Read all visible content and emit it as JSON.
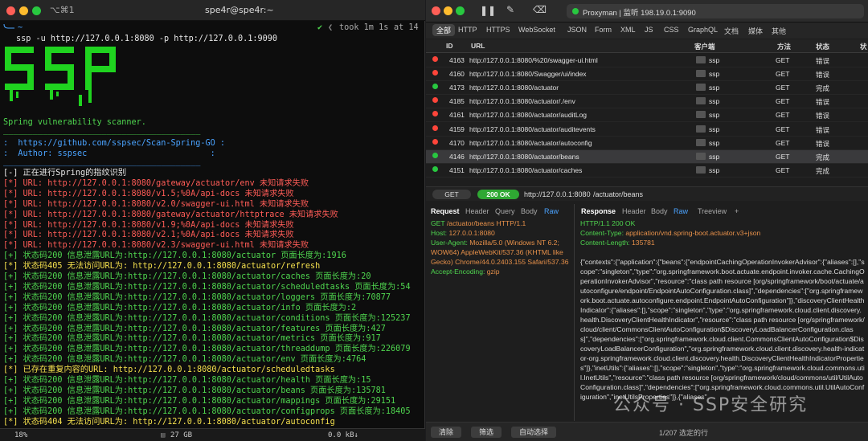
{
  "terminal": {
    "shortcut": "⌥⌘1",
    "title": "spe4r@spe4r:~",
    "prompt_status": "✔",
    "took": "took 1m 1s",
    "at": "at 14",
    "command": "ssp -u http://127.0.0.1:8080 -p http://127.0.0.1:9090",
    "tagline": "Spring vulnerability scanner.",
    "sep": "________________________________________",
    "url_line": ":  https://github.com/sspsec/Scan-Spring-GO :",
    "author_line": ":  Author: sspsec                         :",
    "lines": [
      {
        "text": "[-] 正在进行Spring的指纹识别",
        "color": "#e8e8e8"
      },
      {
        "text": "[*] URL: http://127.0.0.1:8080/gateway/actuator/env 未知请求失败",
        "color": "#ff5c57"
      },
      {
        "text": "[*] URL: http://127.0.0.1:8080/v1.5;%0A/api-docs 未知请求失败",
        "color": "#ff5c57"
      },
      {
        "text": "[*] URL: http://127.0.0.1:8080/v2.0/swagger-ui.html 未知请求失败",
        "color": "#ff5c57"
      },
      {
        "text": "[*] URL: http://127.0.0.1:8080/gateway/actuator/httptrace 未知请求失败",
        "color": "#ff5c57"
      },
      {
        "text": "[*] URL: http://127.0.0.1:8080/v1.9;%0A/api-docs 未知请求失败",
        "color": "#ff5c57"
      },
      {
        "text": "[*] URL: http://127.0.0.1:8080/v2.1;%0A/api-docs 未知请求失败",
        "color": "#ff5c57"
      },
      {
        "text": "[*] URL: http://127.0.0.1:8080/v2.3/swagger-ui.html 未知请求失败",
        "color": "#ff5c57"
      },
      {
        "text": "[+] 状态码200 信息泄露URL为:http://127.0.0.1:8080/actuator 页面长度为:1916",
        "color": "#4fd64f"
      },
      {
        "text": "[*] 状态码405 无法访问URL为: http://127.0.0.1:8080/actuator/refresh",
        "color": "#f4e04d"
      },
      {
        "text": "[+] 状态码200 信息泄露URL为:http://127.0.0.1:8080/actuator/caches 页面长度为:20",
        "color": "#4fd64f"
      },
      {
        "text": "[+] 状态码200 信息泄露URL为:http://127.0.0.1:8080/actuator/scheduledtasks 页面长度为:54",
        "color": "#4fd64f"
      },
      {
        "text": "[+] 状态码200 信息泄露URL为:http://127.0.0.1:8080/actuator/loggers 页面长度为:70877",
        "color": "#4fd64f"
      },
      {
        "text": "[+] 状态码200 信息泄露URL为:http://127.0.0.1:8080/actuator/info 页面长度为:2",
        "color": "#4fd64f"
      },
      {
        "text": "[+] 状态码200 信息泄露URL为:http://127.0.0.1:8080/actuator/conditions 页面长度为:125237",
        "color": "#4fd64f"
      },
      {
        "text": "[+] 状态码200 信息泄露URL为:http://127.0.0.1:8080/actuator/features 页面长度为:427",
        "color": "#4fd64f"
      },
      {
        "text": "[+] 状态码200 信息泄露URL为:http://127.0.0.1:8080/actuator/metrics 页面长度为:917",
        "color": "#4fd64f"
      },
      {
        "text": "[+] 状态码200 信息泄露URL为:http://127.0.0.1:8080/actuator/threaddump 页面长度为:226079",
        "color": "#4fd64f"
      },
      {
        "text": "[+] 状态码200 信息泄露URL为:http://127.0.0.1:8080/actuator/env 页面长度为:4764",
        "color": "#4fd64f"
      },
      {
        "text": "[*] 已存在重复内容的URL: http://127.0.0.1:8080/actuator/scheduledtasks",
        "color": "#f4e04d"
      },
      {
        "text": "[+] 状态码200 信息泄露URL为:http://127.0.0.1:8080/actuator/health 页面长度为:15",
        "color": "#4fd64f"
      },
      {
        "text": "[+] 状态码200 信息泄露URL为:http://127.0.0.1:8080/actuator/beans 页面长度为:135781",
        "color": "#4fd64f"
      },
      {
        "text": "[+] 状态码200 信息泄露URL为:http://127.0.0.1:8080/actuator/mappings 页面长度为:29151",
        "color": "#4fd64f"
      },
      {
        "text": "[+] 状态码200 信息泄露URL为:http://127.0.0.1:8080/actuator/configprops 页面长度为:18405",
        "color": "#4fd64f"
      },
      {
        "text": "[*] 状态码404 无法访问URL为: http://127.0.0.1:8080/actuator/autoconfig",
        "color": "#f4e04d"
      }
    ],
    "status": {
      "cpu": "18%",
      "mem": "27 GB",
      "net": "0.0 kB↓"
    }
  },
  "proxyman": {
    "title": "Proxyman | 监听 198.19.0.1:9090",
    "tabs": [
      "全部",
      "HTTP",
      "HTTPS",
      "WebSocket",
      "JSON",
      "Form",
      "XML",
      "JS",
      "CSS",
      "GraphQL",
      "文档",
      "媒体",
      "其他"
    ],
    "headers": {
      "id": "ID",
      "url": "URL",
      "client": "客户端",
      "method": "方法",
      "status": "状态",
      "extra": "状"
    },
    "rows": [
      {
        "id": "4163",
        "url": "http://127.0.0.1:8080/%20/swagger-ui.html",
        "client": "ssp",
        "method": "GET",
        "status": "错误",
        "ok": false
      },
      {
        "id": "4160",
        "url": "http://127.0.0.1:8080/Swagger/ui/index",
        "client": "ssp",
        "method": "GET",
        "status": "错误",
        "ok": false
      },
      {
        "id": "4173",
        "url": "http://127.0.0.1:8080/actuator",
        "client": "ssp",
        "method": "GET",
        "status": "完成",
        "ok": true
      },
      {
        "id": "4185",
        "url": "http://127.0.0.1:8080/actuator/./env",
        "client": "ssp",
        "method": "GET",
        "status": "错误",
        "ok": false
      },
      {
        "id": "4161",
        "url": "http://127.0.0.1:8080/actuator/auditLog",
        "client": "ssp",
        "method": "GET",
        "status": "错误",
        "ok": false
      },
      {
        "id": "4159",
        "url": "http://127.0.0.1:8080/actuator/auditevents",
        "client": "ssp",
        "method": "GET",
        "status": "错误",
        "ok": false
      },
      {
        "id": "4170",
        "url": "http://127.0.0.1:8080/actuator/autoconfig",
        "client": "ssp",
        "method": "GET",
        "status": "错误",
        "ok": false
      },
      {
        "id": "4146",
        "url": "http://127.0.0.1:8080/actuator/beans",
        "client": "ssp",
        "method": "GET",
        "status": "完成",
        "ok": true
      },
      {
        "id": "4151",
        "url": "http://127.0.0.1:8080/actuator/caches",
        "client": "ssp",
        "method": "GET",
        "status": "完成",
        "ok": true
      }
    ],
    "urlbar": {
      "method": "GET",
      "code": "200 OK",
      "host": "http://127.0.0.1:8080",
      "path": "/actuator/beans"
    },
    "req_tabs": [
      "Request",
      "Header",
      "Query",
      "Body",
      "Raw"
    ],
    "resp_tabs": [
      "Response",
      "Header",
      "Body",
      "Raw",
      "Treeview",
      "+"
    ],
    "request_lines": [
      {
        "k": "GET",
        "v": " /actuator/beans HTTP/1.1"
      },
      {
        "k": "Host:",
        "v": " 127.0.0.1:8080"
      },
      {
        "k": "User-Agent:",
        "v": " Mozilla/5.0 (Windows NT 6.2; WOW64) AppleWebKit/537.36 (KHTML like Gecko) Chrome/44.0.2403.155 Safari/537.36"
      },
      {
        "k": "Accept-Encoding:",
        "v": " gzip"
      }
    ],
    "response_status": "HTTP/1.1 200 OK",
    "response_ct": {
      "k": "Content-Type:",
      "v": " application/vnd.spring-boot.actuator.v3+json"
    },
    "response_cl": {
      "k": "Content-Length:",
      "v": " 135781"
    },
    "response_body": "{\"contexts\":{\"application\":{\"beans\":{\"endpointCachingOperationInvokerAdvisor\":{\"aliases\":[],\"scope\":\"singleton\",\"type\":\"org.springframework.boot.actuate.endpoint.invoker.cache.CachingOperationInvokerAdvisor\",\"resource\":\"class path resource [org/springframework/boot/actuate/autoconfigure/endpoint/EndpointAutoConfiguration.class]\",\"dependencies\":[\"org.springframework.boot.actuate.autoconfigure.endpoint.EndpointAutoConfiguration\"]},\"discoveryClientHealthIndicator\":{\"aliases\":[],\"scope\":\"singleton\",\"type\":\"org.springframework.cloud.client.discovery.health.DiscoveryClientHealthIndicator\",\"resource\":\"class path resource [org/springframework/cloud/client/CommonsClientAutoConfiguration$DiscoveryLoadBalancerConfiguration.class]\",\"dependencies\":[\"org.springframework.cloud.client.CommonsClientAutoConfiguration$DiscoveryLoadBalancerConfiguration\",\"org.springframework.cloud.client.discovery.health-indicator-org.springframework.cloud.client.discovery.health.DiscoveryClientHealthIndicatorProperties\"]},\"inetUtils\":{\"aliases\":[],\"scope\":\"singleton\",\"type\":\"org.springframework.cloud.commons.util.InetUtils\",\"resource\":\"class path resource [org/springframework/cloud/commons/util/UtilAutoConfiguration.class]\",\"dependencies\":[\"org.springframework.cloud.commons.util.UtilAutoConfiguration\",\"inetUtilsProperties\"]},{\"aliases\"",
    "bottom": {
      "clear": "清除",
      "filter": "筛选",
      "auto": "自动选择",
      "count": "1/207 选定的行"
    }
  },
  "watermark": "公众号 · SSP安全研究",
  "colors": {
    "green": "#4fd64f",
    "red": "#ff5c57",
    "yellow": "#f4e04d",
    "blue": "#4aa3ff",
    "orange": "#e8914a"
  }
}
